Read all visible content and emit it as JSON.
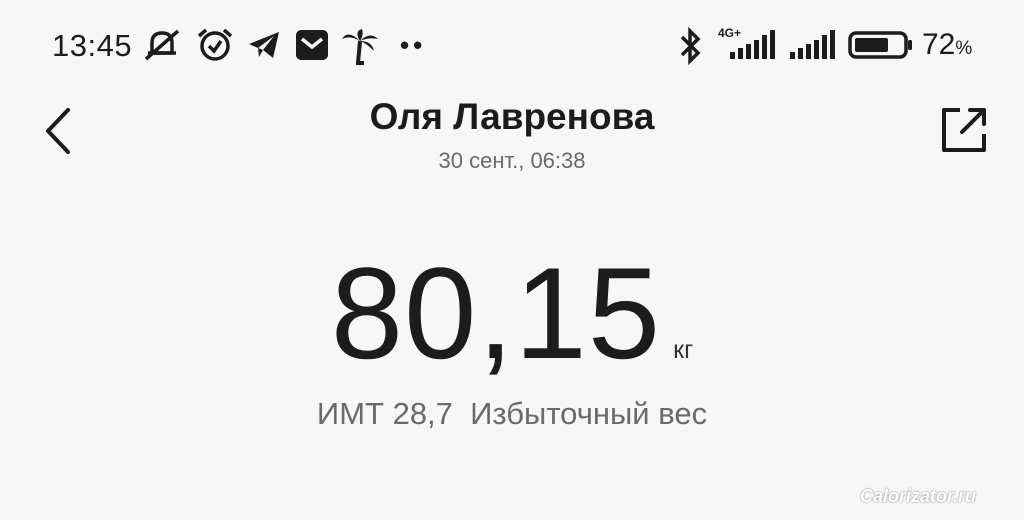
{
  "status_bar": {
    "time": "13:45",
    "network_type": "4G+",
    "battery_percent": "72",
    "battery_unit": "%",
    "battery_level": 0.72,
    "icons": [
      "muted-notifications-icon",
      "alarm-icon",
      "telegram-icon",
      "mail-icon",
      "palm-tree-icon",
      "more-dots-icon",
      "bluetooth-icon",
      "signal-icon",
      "battery-icon"
    ]
  },
  "header": {
    "title": "Оля Лавренова",
    "subtitle": "30 сент., 06:38",
    "back_icon": "chevron-left-icon",
    "share_icon": "share-external-icon"
  },
  "measurement": {
    "weight": "80,15",
    "unit": "кг",
    "bmi_label": "ИМТ 28,7  Избыточный вес"
  },
  "watermark": "Calorizator.ru",
  "colors": {
    "background": "#f7f7f7",
    "text_primary": "#1c1c1c",
    "text_secondary": "#6a6a6a"
  }
}
